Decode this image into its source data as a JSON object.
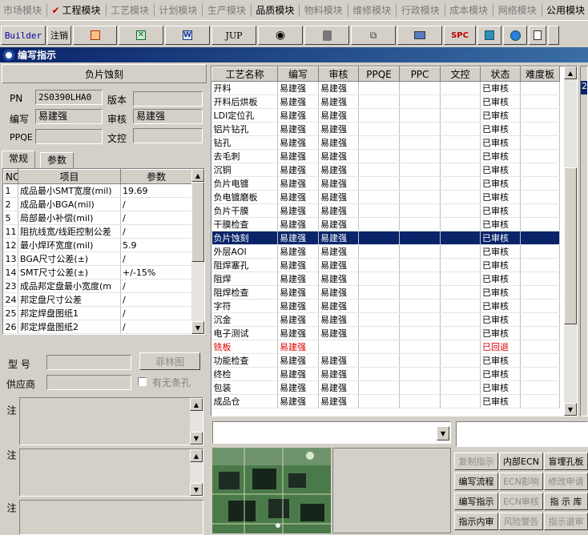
{
  "menubar": {
    "items": [
      {
        "label": "市场模块",
        "active": false
      },
      {
        "label": "工程模块",
        "active": true
      },
      {
        "label": "工艺模块",
        "active": false
      },
      {
        "label": "计划模块",
        "active": false
      },
      {
        "label": "生产模块",
        "active": false
      },
      {
        "label": "品质模块",
        "active": true
      },
      {
        "label": "物料模块",
        "active": false
      },
      {
        "label": "维修模块",
        "active": false
      },
      {
        "label": "行政模块",
        "active": false
      },
      {
        "label": "成本模块",
        "active": false
      },
      {
        "label": "网络模块",
        "active": false
      },
      {
        "label": "公用模块",
        "active": true
      }
    ]
  },
  "toolbar": {
    "builder_label": "Builder",
    "logout_label": "注销",
    "jup_label": "JUP",
    "spc_label": "SPC"
  },
  "window": {
    "title": "编写指示"
  },
  "left": {
    "header": "负片蚀刻",
    "pn_label": "PN",
    "pn_value": "2S0390LHA0",
    "version_label": "版本",
    "version_value": "",
    "author_label": "编写",
    "author_value": "易建强",
    "review_label": "审核",
    "review_value": "易建强",
    "ppqe_label": "PPQE",
    "ppqe_value": "",
    "doc_label": "文控",
    "doc_value": "",
    "tabs": [
      "常规",
      "参数"
    ],
    "param_headers": [
      "NO",
      "项目",
      "参数"
    ],
    "params": [
      {
        "no": "1",
        "item": "成品最小SMT宽度(mil)",
        "val": "19.69"
      },
      {
        "no": "2",
        "item": "成品最小BGA(mil)",
        "val": "/"
      },
      {
        "no": "5",
        "item": "局部最小补偿(mil)",
        "val": "/"
      },
      {
        "no": "11",
        "item": "阻抗线宽/线距控制公差",
        "val": "/"
      },
      {
        "no": "12",
        "item": "最小焊环宽度(mil)",
        "val": "5.9"
      },
      {
        "no": "13",
        "item": "BGA尺寸公差(±)",
        "val": "/"
      },
      {
        "no": "14",
        "item": "SMT尺寸公差(±)",
        "val": "+/-15%"
      },
      {
        "no": "23",
        "item": "成品邦定盘最小宽度(m",
        "val": "/"
      },
      {
        "no": "24",
        "item": "邦定盘尺寸公差",
        "val": "/"
      },
      {
        "no": "25",
        "item": "邦定焊盘图纸1",
        "val": "/"
      },
      {
        "no": "26",
        "item": "邦定焊盘图纸2",
        "val": "/"
      }
    ],
    "model_label": "型  号",
    "model_value": "",
    "supplier_label": "供应商",
    "supplier_value": "",
    "feilin_button": "菲林图",
    "hole_checkbox": "有无条孔",
    "process_note_label": "工艺备注",
    "model_note_label": "型号备注",
    "order_note_label": "订单备注"
  },
  "grid": {
    "headers": [
      "工艺名称",
      "编写",
      "审核",
      "PPQE",
      "PPC",
      "文控",
      "状态",
      "难度板"
    ],
    "rows": [
      {
        "name": "开料",
        "w": "易建强",
        "r": "易建强",
        "status": "已审核",
        "sel": false,
        "red": false
      },
      {
        "name": "开料后烘板",
        "w": "易建强",
        "r": "易建强",
        "status": "已审核",
        "sel": false,
        "red": false
      },
      {
        "name": "LDI定位孔",
        "w": "易建强",
        "r": "易建强",
        "status": "已审核",
        "sel": false,
        "red": false
      },
      {
        "name": "铝片钻孔",
        "w": "易建强",
        "r": "易建强",
        "status": "已审核",
        "sel": false,
        "red": false
      },
      {
        "name": "钻孔",
        "w": "易建强",
        "r": "易建强",
        "status": "已审核",
        "sel": false,
        "red": false
      },
      {
        "name": "去毛刺",
        "w": "易建强",
        "r": "易建强",
        "status": "已审核",
        "sel": false,
        "red": false
      },
      {
        "name": "沉铜",
        "w": "易建强",
        "r": "易建强",
        "status": "已审核",
        "sel": false,
        "red": false
      },
      {
        "name": "负片电镀",
        "w": "易建强",
        "r": "易建强",
        "status": "已审核",
        "sel": false,
        "red": false
      },
      {
        "name": "负电镀磨板",
        "w": "易建强",
        "r": "易建强",
        "status": "已审核",
        "sel": false,
        "red": false
      },
      {
        "name": "负片干膜",
        "w": "易建强",
        "r": "易建强",
        "status": "已审核",
        "sel": false,
        "red": false
      },
      {
        "name": "干膜检查",
        "w": "易建强",
        "r": "易建强",
        "status": "已审核",
        "sel": false,
        "red": false
      },
      {
        "name": "负片蚀刻",
        "w": "易建强",
        "r": "易建强",
        "status": "已审核",
        "sel": true,
        "red": false
      },
      {
        "name": "外层AOI",
        "w": "易建强",
        "r": "易建强",
        "status": "已审核",
        "sel": false,
        "red": false
      },
      {
        "name": "阻焊塞孔",
        "w": "易建强",
        "r": "易建强",
        "status": "已审核",
        "sel": false,
        "red": false
      },
      {
        "name": "阻焊",
        "w": "易建强",
        "r": "易建强",
        "status": "已审核",
        "sel": false,
        "red": false
      },
      {
        "name": "阻焊检查",
        "w": "易建强",
        "r": "易建强",
        "status": "已审核",
        "sel": false,
        "red": false
      },
      {
        "name": "字符",
        "w": "易建强",
        "r": "易建强",
        "status": "已审核",
        "sel": false,
        "red": false
      },
      {
        "name": "沉金",
        "w": "易建强",
        "r": "易建强",
        "status": "已审核",
        "sel": false,
        "red": false
      },
      {
        "name": "电子测试",
        "w": "易建强",
        "r": "易建强",
        "status": "已审核",
        "sel": false,
        "red": false
      },
      {
        "name": "铣板",
        "w": "易建强",
        "r": "",
        "status": "已回退",
        "sel": false,
        "red": true
      },
      {
        "name": "功能检查",
        "w": "易建强",
        "r": "易建强",
        "status": "已审核",
        "sel": false,
        "red": false
      },
      {
        "name": "终检",
        "w": "易建强",
        "r": "易建强",
        "status": "已审核",
        "sel": false,
        "red": false
      },
      {
        "name": "包装",
        "w": "易建强",
        "r": "易建强",
        "status": "已审核",
        "sel": false,
        "red": false
      },
      {
        "name": "成品仓",
        "w": "易建强",
        "r": "易建强",
        "status": "已审核",
        "sel": false,
        "red": false
      }
    ]
  },
  "right_edge_value": "2",
  "buttons": [
    {
      "label": "复制指示",
      "enabled": false
    },
    {
      "label": "内部ECN",
      "enabled": true
    },
    {
      "label": "盲埋孔板",
      "enabled": true
    },
    {
      "label": "编写流程",
      "enabled": true
    },
    {
      "label": "ECN影响",
      "enabled": false
    },
    {
      "label": "修改申请",
      "enabled": false
    },
    {
      "label": "编写指示",
      "enabled": true
    },
    {
      "label": "ECN审核",
      "enabled": false
    },
    {
      "label": "指 示 库",
      "enabled": true
    },
    {
      "label": "指示内审",
      "enabled": true
    },
    {
      "label": "风险警告",
      "enabled": false
    },
    {
      "label": "指示退审",
      "enabled": false
    }
  ]
}
